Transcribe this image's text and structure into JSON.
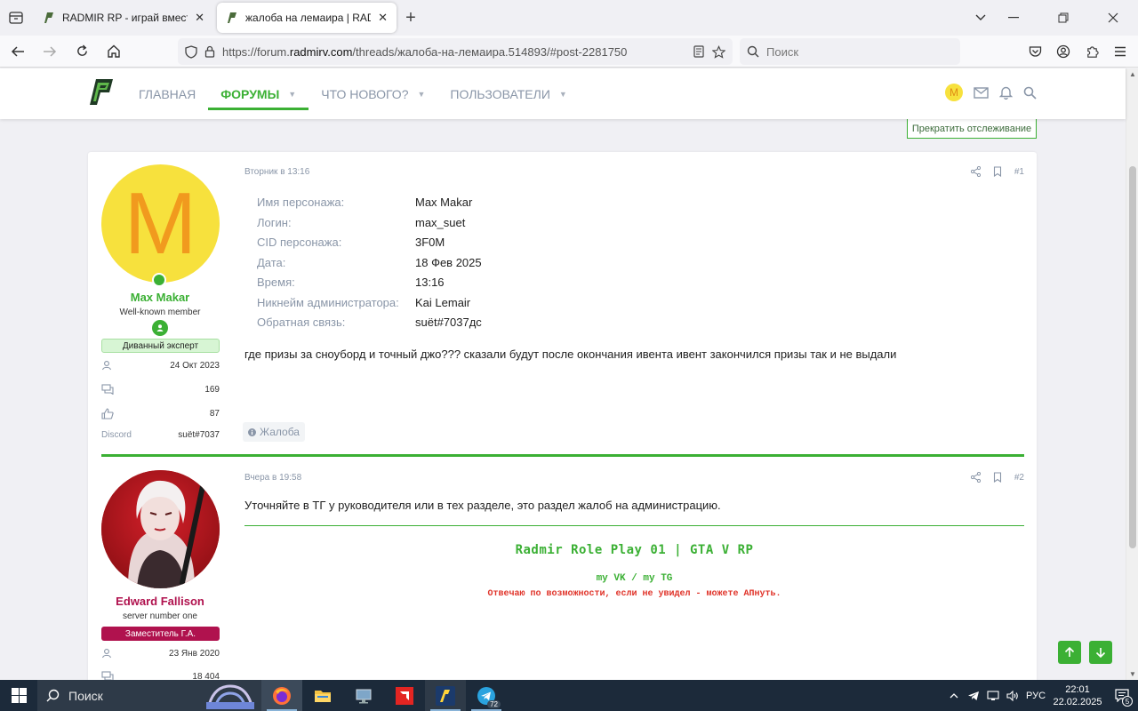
{
  "browser": {
    "tabs": [
      {
        "title": "RADMIR RP - играй вместе со"
      },
      {
        "title": "жалоба на лемаира | RADMIR"
      }
    ],
    "url_prefix": "https://forum.",
    "url_host": "radmirv.com",
    "url_path": "/threads/жалоба-на-лемаира.514893/#post-2281750",
    "search_placeholder": "Поиск"
  },
  "site": {
    "nav": [
      {
        "label": "ГЛАВНАЯ"
      },
      {
        "label": "ФОРУМЫ"
      },
      {
        "label": "ЧТО НОВОГО?"
      },
      {
        "label": "ПОЛЬЗОВАТЕЛИ"
      }
    ],
    "user_initial": "M",
    "unwatch_label": "Прекратить отслеживание"
  },
  "posts": [
    {
      "avatar_letter": "M",
      "username": "Max Makar",
      "user_title": "Well-known member",
      "badge": "Диванный эксперт",
      "stats": [
        {
          "label": "",
          "value": "24 Окт 2023",
          "icon": "user-icon"
        },
        {
          "label": "",
          "value": "169",
          "icon": "messages-icon"
        },
        {
          "label": "",
          "value": "87",
          "icon": "like-icon"
        },
        {
          "label": "Discord",
          "value": "suёt#7037"
        }
      ],
      "date": "Вторник в 13:16",
      "number": "#1",
      "fields": [
        {
          "label": "Имя персонажа:",
          "value": "Max Makar"
        },
        {
          "label": "Логин:",
          "value": "max_suet"
        },
        {
          "label": "CID персонажа:",
          "value": "3F0M"
        },
        {
          "label": "Дата:",
          "value": "18 Фев 2025"
        },
        {
          "label": "Время:",
          "value": "13:16"
        },
        {
          "label": "Никнейм администратора:",
          "value": "Kai Lemair"
        },
        {
          "label": "Обратная связь:",
          "value": "suёt#7037дс"
        }
      ],
      "text": "где призы за сноуборд и точный джо??? сказали будут после окончания ивента ивент закончился призы так и не выдали",
      "tag": "Жалоба"
    },
    {
      "username": "Edward Fallison",
      "user_title": "server number one",
      "badge": "Заместитель Г.А.",
      "stats": [
        {
          "value": "23 Янв 2020"
        },
        {
          "value": "18 404"
        }
      ],
      "date": "Вчера в 19:58",
      "number": "#2",
      "text": "Уточняйте в ТГ у руководителя или в тех разделе, это раздел жалоб на администрацию.",
      "sig_title": "Radmir Role Play 01 | GTA V RP",
      "sig_links": "my VK / my TG",
      "sig_note": "Отвечаю по возможности, если не увидел - можете АПнуть."
    }
  ],
  "taskbar": {
    "search_label": "Поиск",
    "telegram_badge": "72",
    "lang": "РУС",
    "time": "22:01",
    "date": "22.02.2025",
    "notif_count": "5"
  },
  "colors": {
    "accent": "#3bb034",
    "badge_green": "#d7f5d4",
    "badge_red": "#b0124e"
  }
}
